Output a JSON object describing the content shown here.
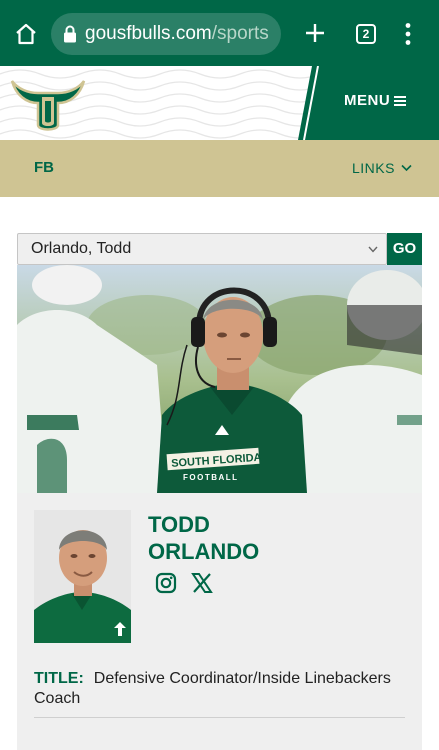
{
  "browser": {
    "url_host": "gousfbulls.com",
    "url_path": "/sports",
    "tab_count": "2",
    "colors": {
      "toolbar": "#006747",
      "urlbar": "#2b8067"
    }
  },
  "site": {
    "menu_label": "MENU",
    "icons": [
      "home-icon",
      "lock-icon",
      "plus-icon",
      "kebab-menu-icon",
      "hamburger-icon",
      "chevron-down-icon",
      "instagram-icon",
      "x-icon"
    ],
    "colors": {
      "primary_green": "#006747",
      "gold": "#cfc493",
      "card_bg": "#efefef"
    }
  },
  "subnav": {
    "sport": "FB",
    "links": "LINKS"
  },
  "roster_select": {
    "selected": "Orlando, Todd",
    "go_label": "GO"
  },
  "profile": {
    "first_name": "TODD",
    "last_name": "ORLANDO",
    "title_label": "TITLE:",
    "title_value": "Defensive Coordinator/Inside Linebackers Coach",
    "shirt_text_line1": "SOUTH FLORIDA",
    "shirt_text_line2": "FOOTBALL"
  }
}
